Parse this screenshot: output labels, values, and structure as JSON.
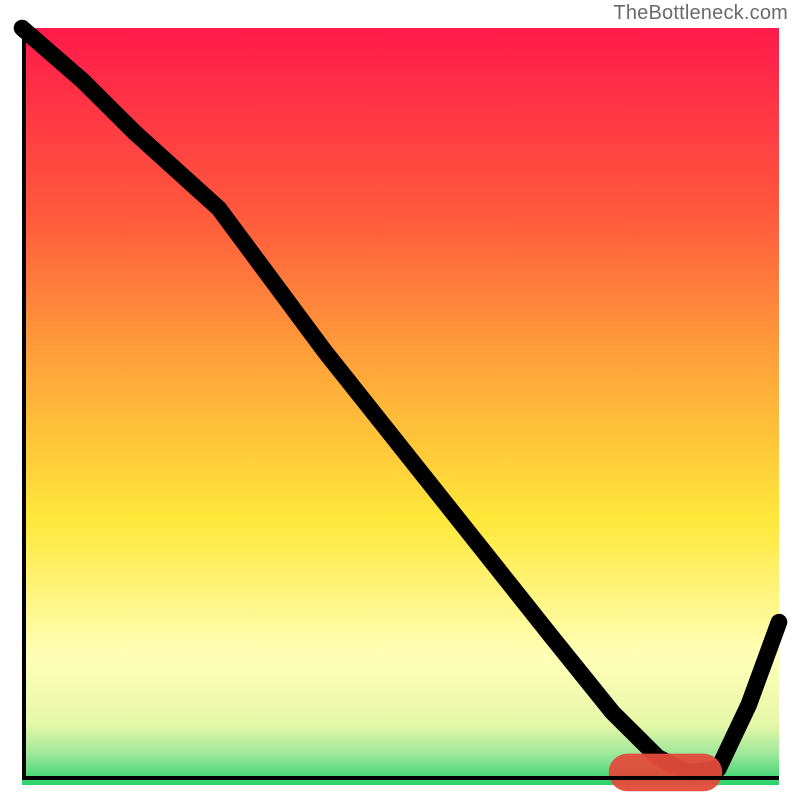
{
  "watermark": "TheBottleneck.com",
  "colors": {
    "grad_top": "#ff1a4b",
    "grad_mid_red": "#ff5a3c",
    "grad_orange": "#ffa63a",
    "grad_yellow": "#ffe83a",
    "grad_pale": "#ffffb8",
    "grad_green_light": "#9de79a",
    "grad_green": "#27d36b",
    "curve": "#000000",
    "highlight": "#e24b3b"
  },
  "chart_data": {
    "type": "line",
    "title": "",
    "xlabel": "",
    "ylabel": "",
    "xlim": [
      0,
      100
    ],
    "ylim": [
      0,
      100
    ],
    "series": [
      {
        "name": "bottleneck-curve",
        "x": [
          0,
          8,
          15,
          26,
          40,
          55,
          70,
          78,
          84,
          88,
          92,
          96,
          100
        ],
        "y": [
          100,
          93,
          86,
          76,
          57,
          38,
          19,
          9,
          3,
          1,
          1.5,
          10,
          21
        ]
      }
    ],
    "annotations": [
      {
        "name": "optimal-range-highlight",
        "x_start": 80,
        "x_end": 90,
        "y": 1,
        "color": "#e24b3b"
      }
    ],
    "background_gradient": {
      "stops": [
        {
          "pos": 0.0,
          "color": "#ff1a4b"
        },
        {
          "pos": 0.25,
          "color": "#ff5a3c"
        },
        {
          "pos": 0.45,
          "color": "#ffa63a"
        },
        {
          "pos": 0.65,
          "color": "#ffe83a"
        },
        {
          "pos": 0.83,
          "color": "#ffffb8"
        },
        {
          "pos": 0.92,
          "color": "#e6f7a8"
        },
        {
          "pos": 0.96,
          "color": "#9de79a"
        },
        {
          "pos": 1.0,
          "color": "#27d36b"
        }
      ]
    }
  }
}
